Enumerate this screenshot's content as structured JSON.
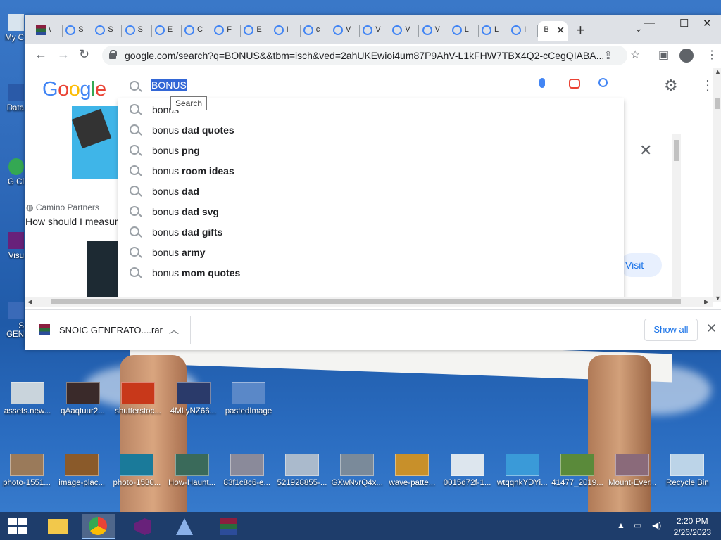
{
  "browser": {
    "tabs": [
      {
        "label": "\\"
      },
      {
        "label": "S"
      },
      {
        "label": "S"
      },
      {
        "label": "S"
      },
      {
        "label": "E"
      },
      {
        "label": "C"
      },
      {
        "label": "F"
      },
      {
        "label": "E"
      },
      {
        "label": "I"
      },
      {
        "label": "c"
      },
      {
        "label": "V"
      },
      {
        "label": "V"
      },
      {
        "label": "V"
      },
      {
        "label": "V"
      },
      {
        "label": "L"
      },
      {
        "label": "L"
      },
      {
        "label": "I"
      },
      {
        "label": "B"
      }
    ],
    "active_tab_close": "✕",
    "new_tab": "+",
    "url": "google.com/search?q=BONUS&&tbm=isch&ved=2ahUKEwioi4um87P9AhV-L1kFHW7TBX4Q2-cCegQIABA..."
  },
  "google": {
    "logo": [
      "G",
      "o",
      "o",
      "g",
      "l",
      "e"
    ],
    "logo_colors": [
      "#4285f4",
      "#ea4335",
      "#fbbc05",
      "#4285f4",
      "#34a853",
      "#ea4335"
    ],
    "query": "BONUS",
    "tooltip": "Search",
    "suggestions": [
      {
        "plain": "bonus",
        "bold": ""
      },
      {
        "plain": "bonus ",
        "bold": "dad quotes"
      },
      {
        "plain": "bonus ",
        "bold": "png"
      },
      {
        "plain": "bonus ",
        "bold": "room ideas"
      },
      {
        "plain": "bonus ",
        "bold": "dad"
      },
      {
        "plain": "bonus ",
        "bold": "dad svg"
      },
      {
        "plain": "bonus ",
        "bold": "dad gifts"
      },
      {
        "plain": "bonus ",
        "bold": "army"
      },
      {
        "plain": "bonus ",
        "bold": "mom quotes"
      }
    ],
    "result_source": "Camino Partners",
    "result_title": "How should I measure",
    "visit_label": "Visit"
  },
  "download": {
    "file_name": "SNOIC GENERATO....rar",
    "show_all": "Show all"
  },
  "desktop": {
    "left_labels": [
      "My C",
      "Data",
      "G Cl",
      "Visu",
      "S GEN"
    ],
    "row1": [
      {
        "label": "assets.new...",
        "color": "#c9d4dc"
      },
      {
        "label": "qAaqtuur2...",
        "color": "#3a2a2a"
      },
      {
        "label": "shutterstoc...",
        "color": "#c8381a"
      },
      {
        "label": "4MLyNZ66...",
        "color": "#2a3a6a"
      },
      {
        "label": "pastedImage",
        "color": "#5a88c8"
      }
    ],
    "row2": [
      {
        "label": "photo-1551...",
        "color": "#9a7a5a"
      },
      {
        "label": "image-plac...",
        "color": "#8a5a2a"
      },
      {
        "label": "photo-1530...",
        "color": "#1a7a9a"
      },
      {
        "label": "How-Haunt...",
        "color": "#3a6a5a"
      },
      {
        "label": "83f1c8c6-e...",
        "color": "#8a8a9a"
      },
      {
        "label": "521928855-...",
        "color": "#aabacc"
      },
      {
        "label": "GXwNvrQ4x...",
        "color": "#7a8a9a"
      },
      {
        "label": "wave-patte...",
        "color": "#c8902a"
      },
      {
        "label": "0015d72f-1...",
        "color": "#dde6ee"
      },
      {
        "label": "wtqqnkYDYi...",
        "color": "#3a9ad8"
      },
      {
        "label": "41477_2019...",
        "color": "#5a8a3a"
      },
      {
        "label": "Mount-Ever...",
        "color": "#8a6a7a"
      },
      {
        "label": "Recycle Bin",
        "color": "#bcd4e8"
      }
    ]
  },
  "taskbar": {
    "time": "2:20 PM",
    "date": "2/26/2023"
  }
}
